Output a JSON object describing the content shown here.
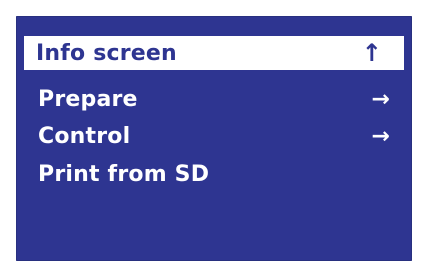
{
  "menu": {
    "items": [
      {
        "label": "Info screen",
        "icon": "↑",
        "selected": true
      },
      {
        "label": "Prepare",
        "icon": "→",
        "selected": false
      },
      {
        "label": "Control",
        "icon": "→",
        "selected": false
      },
      {
        "label": "Print from SD",
        "icon": "",
        "selected": false
      }
    ]
  },
  "colors": {
    "screen_background": "#2e3591",
    "text": "#ffffff",
    "selection_background": "#ffffff",
    "selection_text": "#2e3591"
  }
}
